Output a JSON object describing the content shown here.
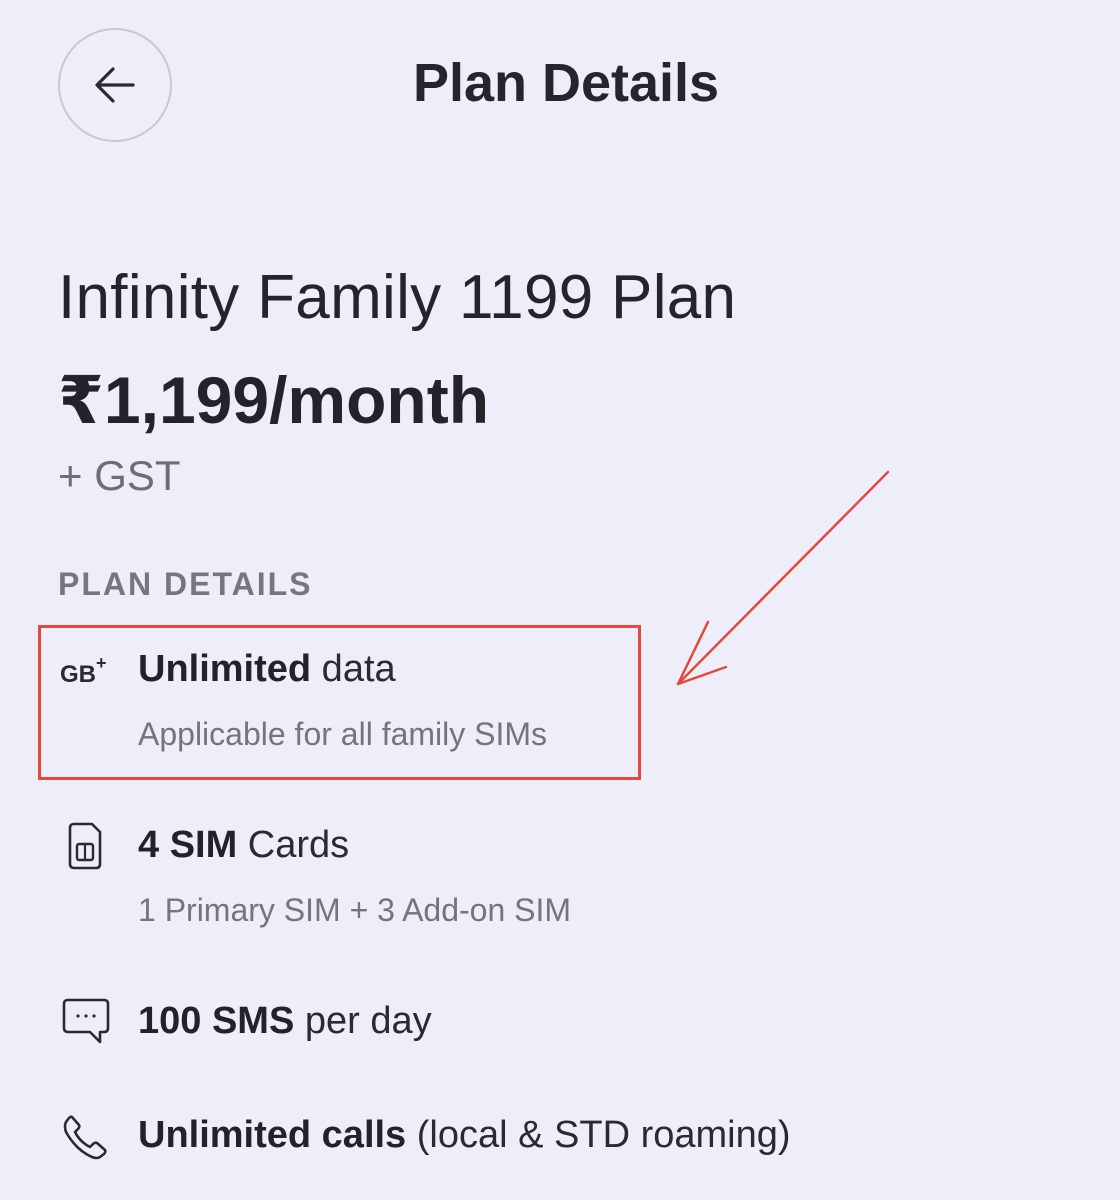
{
  "header": {
    "title": "Plan Details",
    "back_icon": "arrow-left-icon"
  },
  "plan": {
    "name": "Infinity Family 1199 Plan",
    "price": "₹1,199/month",
    "tax": "+ GST"
  },
  "section_label": "PLAN DETAILS",
  "features": [
    {
      "icon": "gb-plus-icon",
      "icon_text": "GB",
      "icon_sup": "+",
      "bold": "Unlimited",
      "rest": " data",
      "sub": "Applicable for all family SIMs"
    },
    {
      "icon": "sim-card-icon",
      "bold": "4 SIM",
      "rest": " Cards",
      "sub": "1 Primary SIM + 3 Add-on SIM"
    },
    {
      "icon": "chat-bubble-icon",
      "bold": "100 SMS",
      "rest": " per day"
    },
    {
      "icon": "phone-icon",
      "bold": "Unlimited calls",
      "rest": " (local & STD roaming)"
    }
  ],
  "colors": {
    "background": "#eeeefb",
    "highlight": "#e34a3c",
    "text_primary": "#222228",
    "text_secondary": "#74747b"
  }
}
